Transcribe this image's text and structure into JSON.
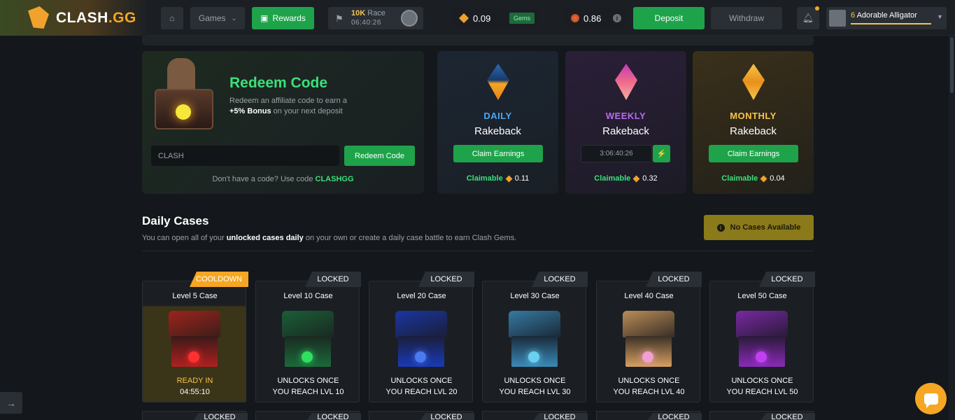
{
  "header": {
    "logo_text": "CLASH",
    "logo_suffix": ".GG",
    "games_label": "Games",
    "rewards_label": "Rewards",
    "race": {
      "prize": "10K",
      "label": "Race",
      "timer": "06:40:26"
    },
    "gem_balance": "0.09",
    "gems_badge": "Gems",
    "coin_balance": "0.86",
    "deposit_label": "Deposit",
    "withdraw_label": "Withdraw",
    "user": {
      "level": "6",
      "name": "Adorable Alligator"
    }
  },
  "redeem": {
    "title": "Redeem Code",
    "desc_line1": "Redeem an affiliate code to earn a",
    "bonus": "+5% Bonus",
    "desc_line2": "on your next deposit",
    "input_value": "CLASH",
    "button_label": "Redeem Code",
    "hint_text": "Don't have a code? Use code",
    "hint_code": "CLASHGG"
  },
  "rakeback": {
    "daily": {
      "kind": "DAILY",
      "title": "Rakeback",
      "action": "Claim Earnings",
      "claimable_label": "Claimable",
      "amount": "0.11"
    },
    "weekly": {
      "kind": "WEEKLY",
      "title": "Rakeback",
      "timer": "3:06:40:26",
      "bolt": "⚡",
      "claimable_label": "Claimable",
      "amount": "0.32"
    },
    "monthly": {
      "kind": "MONTHLY",
      "title": "Rakeback",
      "action": "Claim Earnings",
      "claimable_label": "Claimable",
      "amount": "0.04"
    }
  },
  "daily_cases": {
    "title": "Daily Cases",
    "desc_pre": "You can open all of your",
    "desc_bold": "unlocked cases daily",
    "desc_post": "on your own or create a daily case battle to earn Clash Gems.",
    "no_cases": "No Cases Available",
    "cases": [
      {
        "tag": "COOLDOWN",
        "name": "Level 5 Case",
        "status1": "READY IN",
        "status2": "04:55:10"
      },
      {
        "tag": "LOCKED",
        "name": "Level 10 Case",
        "status1": "UNLOCKS ONCE",
        "status2": "YOU REACH LVL 10"
      },
      {
        "tag": "LOCKED",
        "name": "Level 20 Case",
        "status1": "UNLOCKS ONCE",
        "status2": "YOU REACH LVL 20"
      },
      {
        "tag": "LOCKED",
        "name": "Level 30 Case",
        "status1": "UNLOCKS ONCE",
        "status2": "YOU REACH LVL 30"
      },
      {
        "tag": "LOCKED",
        "name": "Level 40 Case",
        "status1": "UNLOCKS ONCE",
        "status2": "YOU REACH LVL 40"
      },
      {
        "tag": "LOCKED",
        "name": "Level 50 Case",
        "status1": "UNLOCKS ONCE",
        "status2": "YOU REACH LVL 50"
      }
    ],
    "row2_tag": "LOCKED"
  },
  "colors": {
    "accent_green": "#1ea34a",
    "gold": "#f5a623",
    "daily": "#4aa8f0",
    "weekly": "#b86af0",
    "monthly": "#f5c54a"
  }
}
